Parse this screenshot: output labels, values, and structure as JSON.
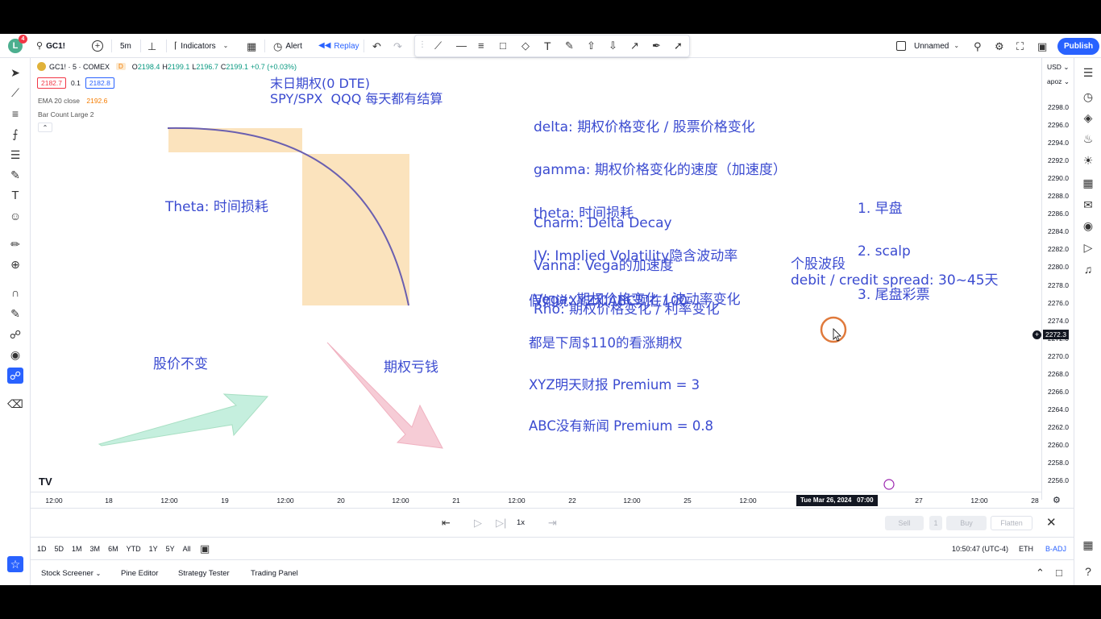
{
  "topbar": {
    "avatar_letter": "L",
    "avatar_badge": "4",
    "symbol": "GC1!",
    "interval": "5m",
    "indicators_label": "Indicators",
    "alert_label": "Alert",
    "replay_label": "Replay",
    "layout_name": "Unnamed",
    "publish_label": "Publish"
  },
  "legend": {
    "symbol_line": "GC1! · 5 · COMEX",
    "source_badge": "D",
    "open_label": "O",
    "open": "2198.4",
    "high_label": "H",
    "high": "2199.1",
    "low_label": "L",
    "low": "2196.7",
    "close_label": "C",
    "close": "2199.1",
    "change": "+0.7 (+0.03%)",
    "bid": "2182.7",
    "spread": "0.1",
    "ask": "2182.8",
    "ema_label": "EMA 20 close",
    "ema_value": "2192.6",
    "bar_count": "Bar Count Large 2"
  },
  "price_axis": {
    "currency": "USD",
    "unit": "apoz",
    "ticks": [
      "2298.0",
      "2296.0",
      "2294.0",
      "2292.0",
      "2290.0",
      "2288.0",
      "2286.0",
      "2284.0",
      "2282.0",
      "2280.0",
      "2278.0",
      "2276.0",
      "2274.0",
      "2272.0",
      "2270.0",
      "2268.0",
      "2266.0",
      "2264.0",
      "2262.0",
      "2260.0",
      "2258.0",
      "2256.0"
    ],
    "current_price": "2272.3"
  },
  "time_axis": {
    "ticks": [
      "12:00",
      "18",
      "12:00",
      "19",
      "12:00",
      "20",
      "12:00",
      "21",
      "12:00",
      "22",
      "12:00",
      "25",
      "12:00",
      "12:00",
      "27",
      "12:00",
      "28"
    ],
    "crosshair_label": "Tue Mar 26, 2024   07:00"
  },
  "replay_bar": {
    "speed": "1x",
    "sell_label": "Sell",
    "qty": "1",
    "buy_label": "Buy",
    "flatten_label": "Flatten"
  },
  "range_bar": {
    "ranges": [
      "1D",
      "5D",
      "1M",
      "3M",
      "6M",
      "YTD",
      "1Y",
      "5Y",
      "All"
    ],
    "clock": "10:50:47 (UTC-4)",
    "session": "ETH",
    "adjust": "B-ADJ"
  },
  "bottom_tabs": [
    "Stock Screener",
    "Pine Editor",
    "Strategy Tester",
    "Trading Panel"
  ],
  "annotations": {
    "zero_dte_title": "末日期权(0 DTE)",
    "zero_dte_sub": "SPY/SPX  QQQ 每天都有结算",
    "theta_label": "Theta: 时间损耗",
    "greeks": [
      "delta: 期权价格变化 / 股票价格变化",
      "gamma: 期权价格变化的速度（加速度）",
      "theta: 时间损耗",
      "IV: Implied Volatility隐含波动率",
      "Vega: 期权价格变化 / 波动率变化"
    ],
    "greeks2": [
      "Charm: Delta Decay",
      "Vanna: Vega的加速度",
      "Rho: 期权价格变化 / 利率变化"
    ],
    "strategy": [
      "1. 早盘",
      "2. scalp",
      "3. 尾盘彩票"
    ],
    "example": [
      "假如说XYZ和ABC现在100",
      "都是下周$110的看涨期权",
      "XYZ明天财报 Premium = 3",
      "ABC没有新闻 Premium = 0.8"
    ],
    "swing_title": "个股波段",
    "swing_text": "debit / credit spread: 30~45天",
    "stock_flat": "股价不变",
    "option_loss": "期权亏钱"
  },
  "colors": {
    "accent": "#2962ff",
    "ink": "#3b4bd0",
    "theta_box": "#fbe3bd",
    "green_arrow": "#a8e6c8",
    "pink_arrow": "#f2b8c6",
    "cursor_ring": "#e07a3c"
  }
}
